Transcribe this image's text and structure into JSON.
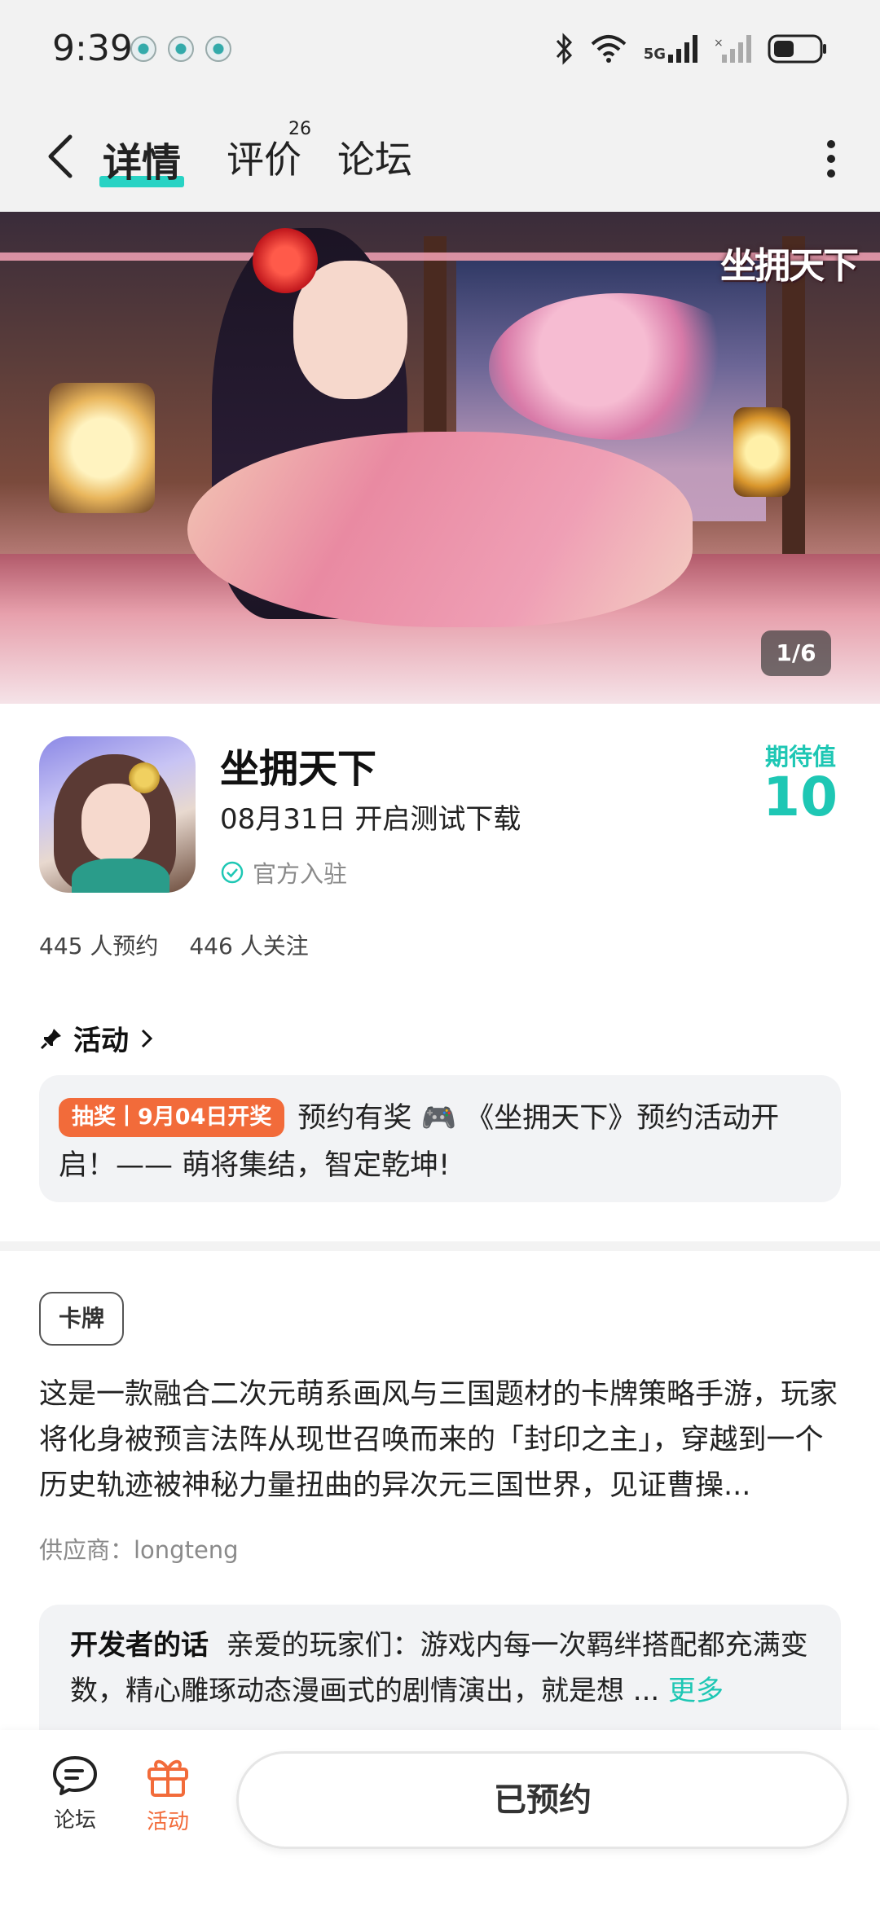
{
  "status": {
    "time": "9:39",
    "network": "5G"
  },
  "nav": {
    "tabs": [
      {
        "label": "详情",
        "active": true
      },
      {
        "label": "评价",
        "badge": "26"
      },
      {
        "label": "论坛"
      }
    ]
  },
  "banner": {
    "logo_text": "坐拥天下",
    "counter": "1/6"
  },
  "game": {
    "title": "坐拥天下",
    "date_line": "08月31日 开启测试下载",
    "official_label": "官方入驻",
    "score_label": "期待值",
    "score_value": "10",
    "reservations": "445 人预约",
    "followers": "446 人关注"
  },
  "activity": {
    "section_title": "活动",
    "badge": "抽奖丨9月04日开奖",
    "text": "预约有奖 🎮 《坐拥天下》预约活动开启！—— 萌将集结，智定乾坤!"
  },
  "description": {
    "tag": "卡牌",
    "text": "这是一款融合二次元萌系画风与三国题材的卡牌策略手游，玩家将化身被预言法阵从现世召唤而来的「封印之主」，穿越到一个历史轨迹被神秘力量扭曲的异次元三国世界，见证曹操...",
    "supplier": "供应商：longteng"
  },
  "developer": {
    "label": "开发者的话",
    "text": "亲爱的玩家们：游戏内每一次羁绊搭配都充满变数，精心雕琢动态漫画式的剧情演出，就是想 ...",
    "more": "更多"
  },
  "bottom": {
    "forum_label": "论坛",
    "activity_label": "活动",
    "reserve_button": "已预约"
  },
  "colors": {
    "accent": "#1ec7b4",
    "tab_underline": "#28d3c4",
    "activity_orange": "#f26b3a"
  }
}
